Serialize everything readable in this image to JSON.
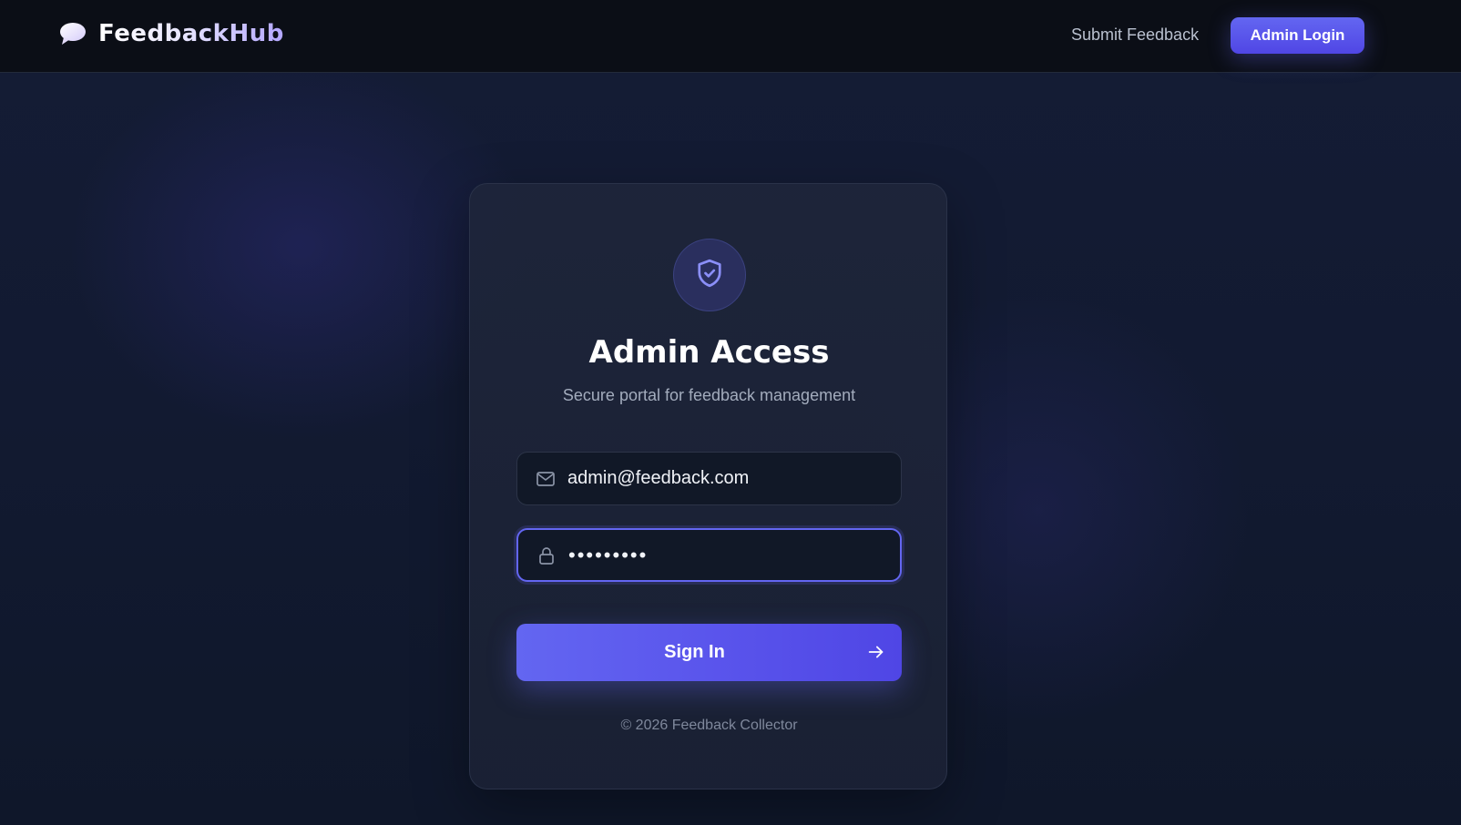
{
  "header": {
    "brand_name": "FeedbackHub",
    "brand_icon": "speech-bubble-icon",
    "nav_link": "Submit Feedback",
    "nav_button": "Admin Login"
  },
  "login": {
    "icon": "shield-check-icon",
    "title": "Admin Access",
    "subtitle": "Secure portal for feedback management",
    "email": {
      "icon": "mail-icon",
      "value": "admin@feedback.com",
      "placeholder": ""
    },
    "password": {
      "icon": "lock-icon",
      "value": "•••••••••"
    },
    "submit_label": "Sign In",
    "submit_icon": "arrow-right-icon",
    "footer": "© 2026 Feedback Collector"
  },
  "colors": {
    "accent": "#6366f1",
    "accent_dark": "#4f46e5",
    "header_bg": "#0b0e16",
    "page_bg": "#111a2e",
    "card_bg": "#1e253a",
    "input_bg": "#111827"
  }
}
